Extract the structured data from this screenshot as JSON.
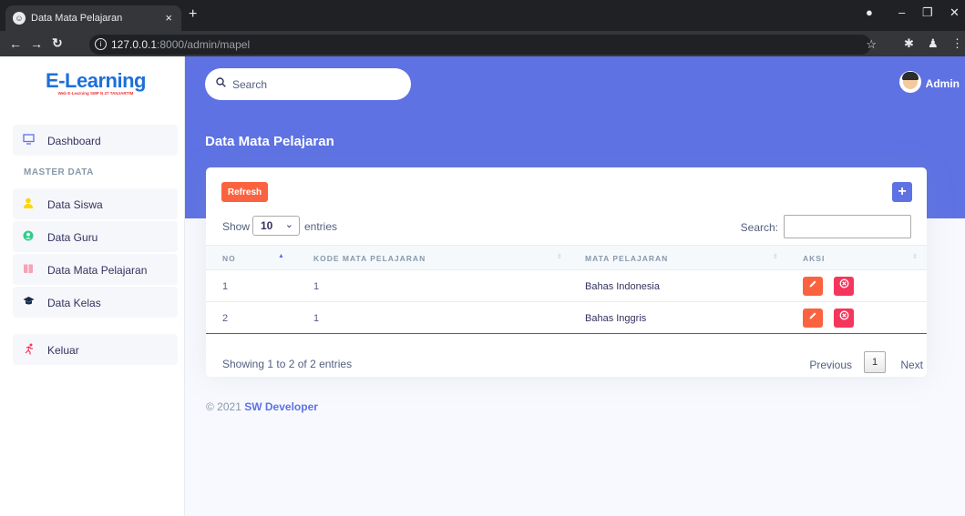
{
  "browser": {
    "tab_title": "Data Mata Pelajaran",
    "url_host": "127.0.0.1",
    "url_rest": ":8000/admin/mapel"
  },
  "sidebar": {
    "logo_title": "E-Learning",
    "logo_subtitle": "Web E-Learning SMP N 27 TANJARTIM",
    "section_label": "MASTER DATA",
    "items": [
      {
        "label": "Dashboard",
        "icon": "monitor-icon"
      },
      {
        "label": "Data Siswa",
        "icon": "person-icon"
      },
      {
        "label": "Data Guru",
        "icon": "user-circle-icon"
      },
      {
        "label": "Data Mata Pelajaran",
        "icon": "book-icon"
      },
      {
        "label": "Data Kelas",
        "icon": "graduation-cap-icon"
      },
      {
        "label": "Keluar",
        "icon": "running-person-icon"
      }
    ]
  },
  "header": {
    "search_placeholder": "Search",
    "username": "Admin",
    "page_title": "Data Mata Pelajaran"
  },
  "card": {
    "refresh_label": "Refresh",
    "add_label": "+",
    "show_label": "Show",
    "entries_label": "entries",
    "page_length": "10",
    "search_label": "Search:",
    "columns": [
      "NO",
      "KODE MATA PELAJARAN",
      "MATA PELAJARAN",
      "AKSI"
    ],
    "rows": [
      {
        "no": "1",
        "kode": "1",
        "mapel": "Bahas Indonesia"
      },
      {
        "no": "2",
        "kode": "1",
        "mapel": "Bahas Inggris"
      }
    ],
    "showing": "Showing 1 to 2 of 2 entries",
    "prev_label": "Previous",
    "current_page": "1",
    "next_label": "Next"
  },
  "footer": {
    "copyright": "© 2021",
    "brand": "SW Developer"
  },
  "colors": {
    "primary": "#5e72e4",
    "warning": "#fb6340",
    "danger": "#f5365c"
  }
}
